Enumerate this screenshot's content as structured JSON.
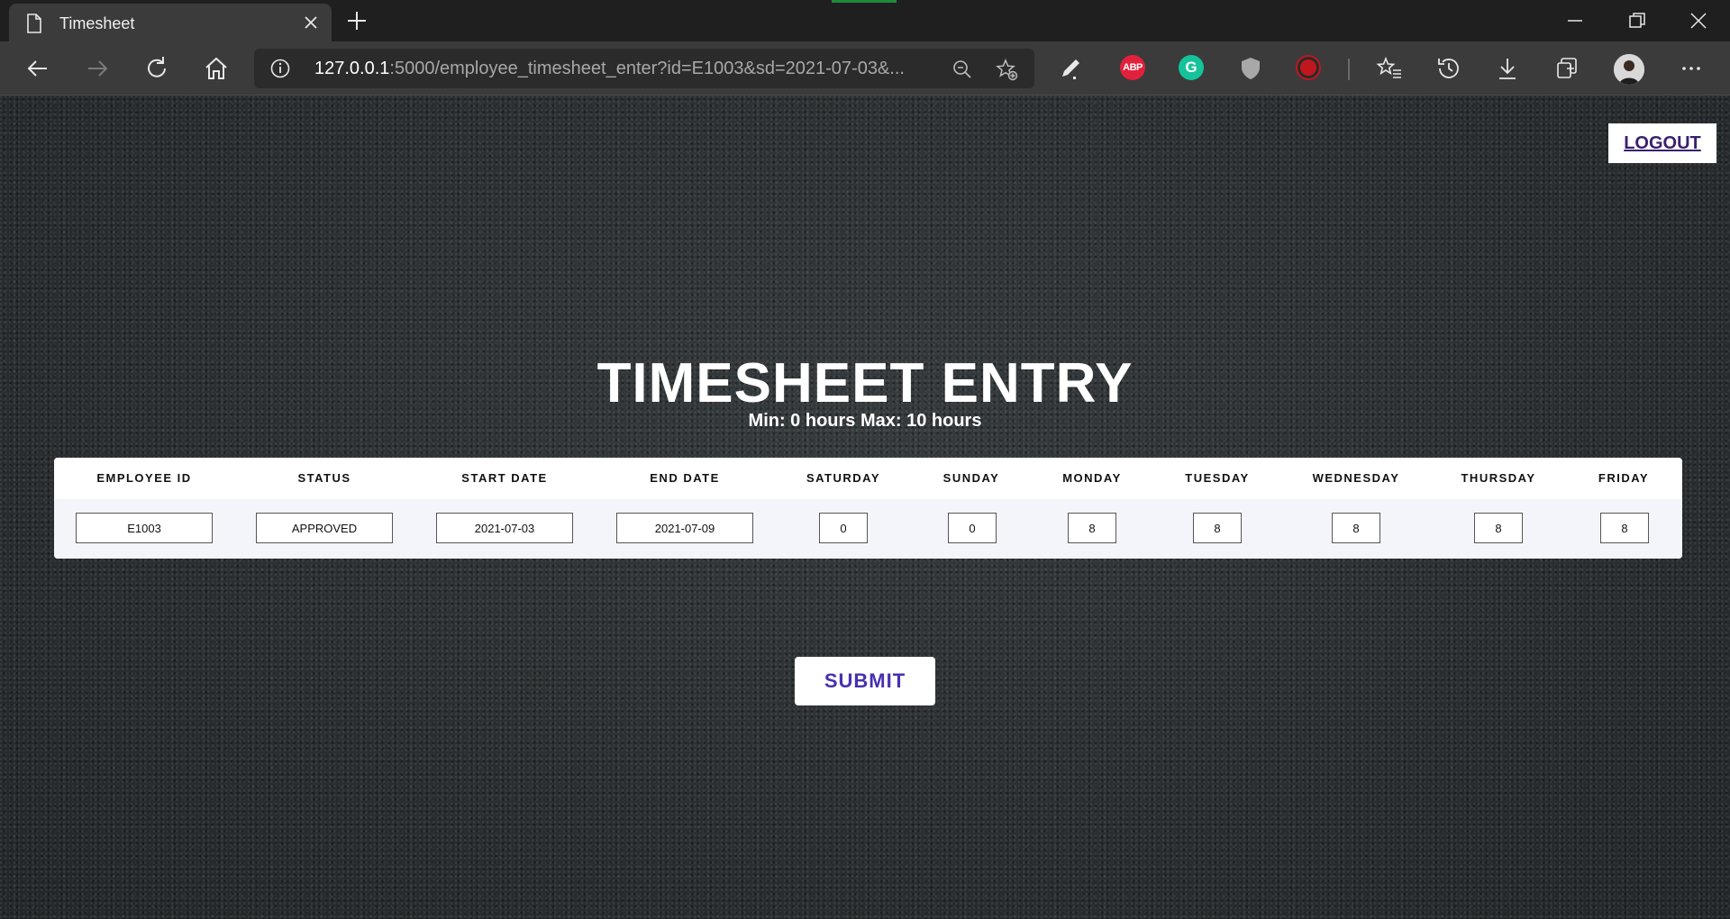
{
  "browser": {
    "tab_title": "Timesheet",
    "url_host": "127.0.0.1",
    "url_rest": ":5000/employee_timesheet_enter?id=E1003&sd=2021-07-03&...",
    "extensions": {
      "abp_label": "ABP",
      "grammarly_label": "G"
    }
  },
  "page": {
    "logout_label": "LOGOUT",
    "title": "TIMESHEET ENTRY",
    "subtitle": "Min: 0 hours Max: 10 hours",
    "submit_label": "SUBMIT"
  },
  "table": {
    "headers": [
      "EMPLOYEE ID",
      "STATUS",
      "START DATE",
      "END DATE",
      "SATURDAY",
      "SUNDAY",
      "MONDAY",
      "TUESDAY",
      "WEDNESDAY",
      "THURSDAY",
      "FRIDAY"
    ],
    "row": [
      "E1003",
      "APPROVED",
      "2021-07-03",
      "2021-07-09",
      "0",
      "0",
      "8",
      "8",
      "8",
      "8",
      "8"
    ]
  },
  "colors": {
    "logout_text": "#3b1f6e",
    "submit_text": "#4a2fb0",
    "abp_red": "#e3203c",
    "grammarly_green": "#15c39a"
  },
  "icons": [
    "document-icon",
    "close-icon",
    "plus-icon",
    "minimize-icon",
    "restore-icon",
    "window-close-icon",
    "back-arrow-icon",
    "forward-arrow-icon",
    "refresh-icon",
    "home-icon",
    "info-icon",
    "zoom-out-icon",
    "favorite-add-icon",
    "pen-icon",
    "shield-icon",
    "favorites-icon",
    "history-icon",
    "download-icon",
    "collections-icon",
    "more-icon"
  ]
}
